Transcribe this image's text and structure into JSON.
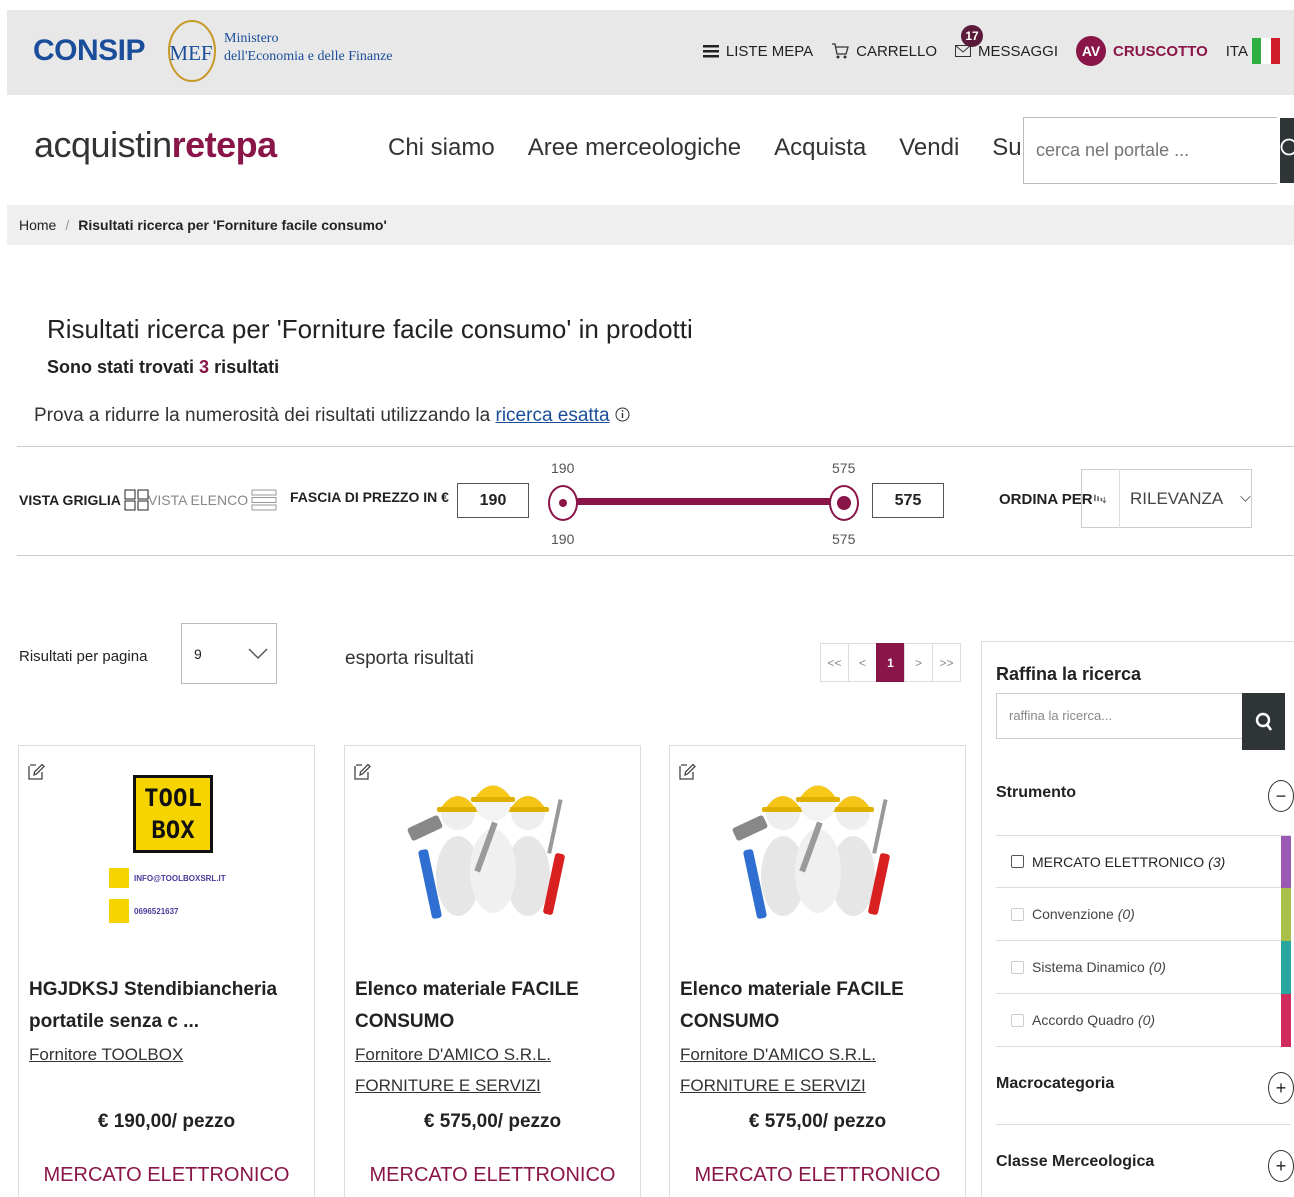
{
  "topbar": {
    "consip": "CONSIP",
    "mef_logo": "MEF",
    "mef_line1": "Ministero",
    "mef_line2": "dell'Economia e delle Finanze",
    "liste": "LISTE MEPA",
    "carrello": "CARRELLO",
    "messaggi": "MESSAGGI",
    "messaggi_count": "17",
    "avatar": "AV",
    "cruscotto": "CRUSCOTTO",
    "lang": "ITA",
    "flag_colors": [
      "#2eaf3f",
      "#ffffff",
      "#d21e2b"
    ]
  },
  "header": {
    "brand_a": "acquistin",
    "brand_b": "rete",
    "brand_c": "pa",
    "nav": [
      "Chi siamo",
      "Aree merceologiche",
      "Acquista",
      "Vendi",
      "Supporto"
    ],
    "search_placeholder": "cerca nel portale ..."
  },
  "breadcrumb": {
    "home": "Home",
    "separator": "/",
    "current": "Risultati ricerca per 'Forniture facile consumo'"
  },
  "results": {
    "title": "Risultati ricerca per 'Forniture facile consumo' in prodotti",
    "count_pre": "Sono stati trovati",
    "count": "3",
    "count_post": "risultati",
    "hint_text": "Prova a ridurre la numerosità dei risultati utilizzando la",
    "hint_link": "ricerca esatta"
  },
  "filters": {
    "vista_griglia": "VISTA GRIGLIA",
    "vista_elenco": "VISTA ELENCO",
    "fascia": "FASCIA DI PREZZO IN €",
    "min": "190",
    "max": "575",
    "ordina": "ORDINA PER",
    "sort": "RILEVANZA"
  },
  "paging": {
    "rpp_label": "Risultati per pagina",
    "rpp_value": "9",
    "esporta": "esporta risultati",
    "pages": [
      "<<",
      "<",
      "1",
      ">",
      ">>"
    ]
  },
  "cards": [
    {
      "name": "HGJDKSJ Stendibiancheria portatile senza c ...",
      "supplier": "Fornitore TOOLBOX",
      "price": "€ 190,00/ pezzo",
      "tool": "MERCATO ELETTRONICO",
      "logo_l1": "TOOL",
      "logo_l2": "BOX",
      "logo_email": "INFO@TOOLBOXSRL.IT",
      "logo_phone": "0696521637"
    },
    {
      "name": "Elenco materiale FACILE CONSUMO",
      "supplier": "Fornitore D'AMICO S.R.L. FORNITURE E SERVIZI",
      "price": "€ 575,00/ pezzo",
      "tool": "MERCATO ELETTRONICO"
    },
    {
      "name": "Elenco materiale FACILE CONSUMO",
      "supplier": "Fornitore D'AMICO S.R.L. FORNITURE E SERVIZI",
      "price": "€ 575,00/ pezzo",
      "tool": "MERCATO ELETTRONICO"
    }
  ],
  "sidebar": {
    "title": "Raffina la ricerca",
    "search_placeholder": "raffina la ricerca...",
    "strumento": "Strumento",
    "options": [
      {
        "label": "MERCATO ELETTRONICO",
        "count": "(3)",
        "color": "#9b59b6"
      },
      {
        "label": "Convenzione",
        "count": "(0)",
        "color": "#a8c04a"
      },
      {
        "label": "Sistema Dinamico",
        "count": "(0)",
        "color": "#2aa6a0"
      },
      {
        "label": "Accordo Quadro",
        "count": "(0)",
        "color": "#d12a5c"
      }
    ],
    "macrocategoria": "Macrocategoria",
    "classe": "Classe Merceologica"
  },
  "colors": {
    "accent": "#8a1548",
    "consip_blue": "#1a4e9a",
    "dark_button": "#2f3537"
  }
}
